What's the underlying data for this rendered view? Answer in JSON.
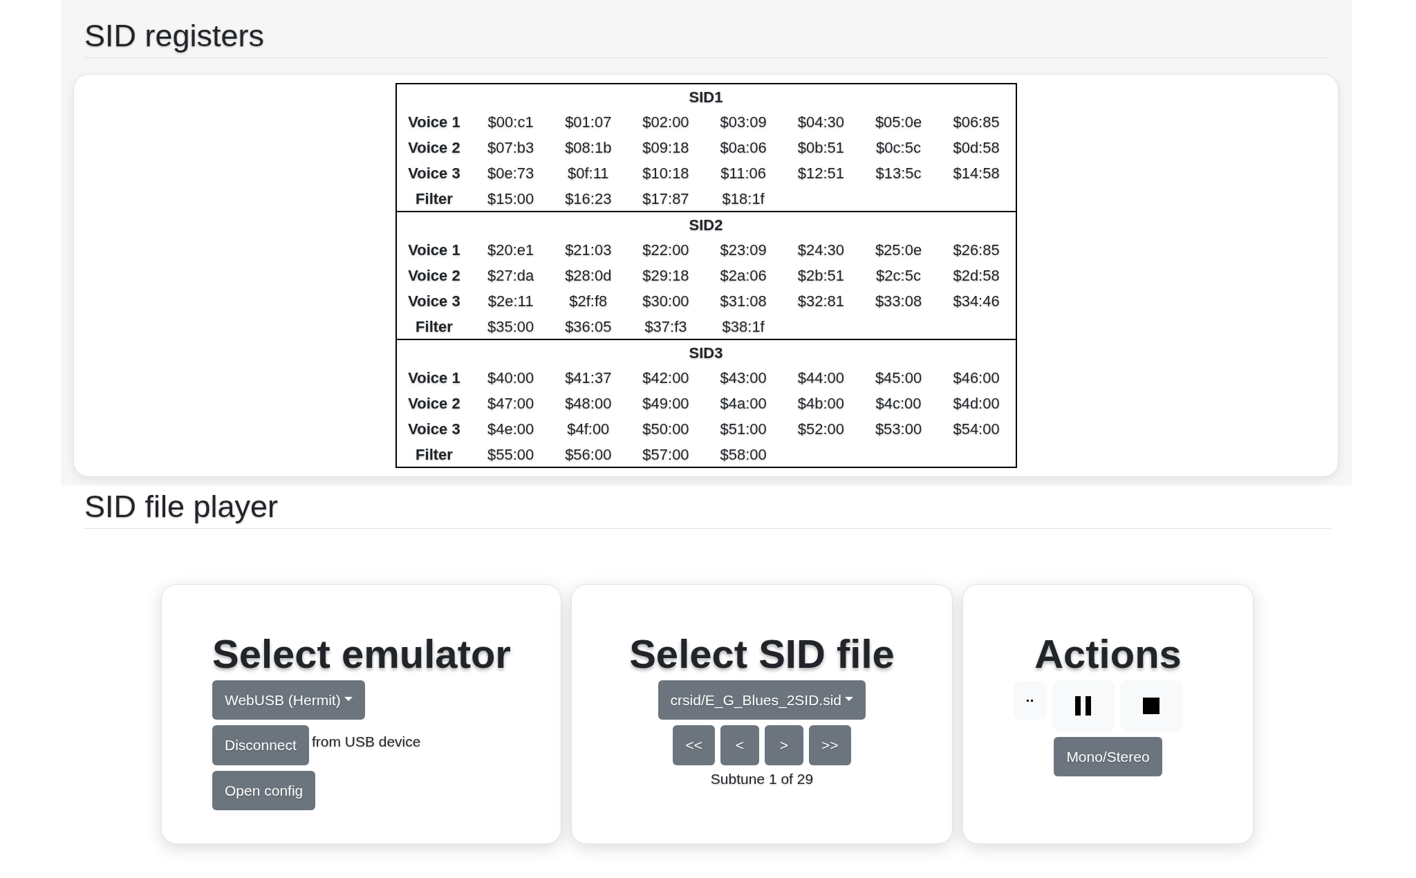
{
  "registers": {
    "heading": "SID registers",
    "chips": [
      {
        "name": "SID1",
        "rows": [
          {
            "label": "Voice 1",
            "cells": [
              "$00:c1",
              "$01:07",
              "$02:00",
              "$03:09",
              "$04:30",
              "$05:0e",
              "$06:85"
            ]
          },
          {
            "label": "Voice 2",
            "cells": [
              "$07:b3",
              "$08:1b",
              "$09:18",
              "$0a:06",
              "$0b:51",
              "$0c:5c",
              "$0d:58"
            ]
          },
          {
            "label": "Voice 3",
            "cells": [
              "$0e:73",
              "$0f:11",
              "$10:18",
              "$11:06",
              "$12:51",
              "$13:5c",
              "$14:58"
            ]
          },
          {
            "label": "Filter",
            "cells": [
              "$15:00",
              "$16:23",
              "$17:87",
              "$18:1f"
            ]
          }
        ]
      },
      {
        "name": "SID2",
        "rows": [
          {
            "label": "Voice 1",
            "cells": [
              "$20:e1",
              "$21:03",
              "$22:00",
              "$23:09",
              "$24:30",
              "$25:0e",
              "$26:85"
            ]
          },
          {
            "label": "Voice 2",
            "cells": [
              "$27:da",
              "$28:0d",
              "$29:18",
              "$2a:06",
              "$2b:51",
              "$2c:5c",
              "$2d:58"
            ]
          },
          {
            "label": "Voice 3",
            "cells": [
              "$2e:11",
              "$2f:f8",
              "$30:00",
              "$31:08",
              "$32:81",
              "$33:08",
              "$34:46"
            ]
          },
          {
            "label": "Filter",
            "cells": [
              "$35:00",
              "$36:05",
              "$37:f3",
              "$38:1f"
            ]
          }
        ]
      },
      {
        "name": "SID3",
        "rows": [
          {
            "label": "Voice 1",
            "cells": [
              "$40:00",
              "$41:37",
              "$42:00",
              "$43:00",
              "$44:00",
              "$45:00",
              "$46:00"
            ]
          },
          {
            "label": "Voice 2",
            "cells": [
              "$47:00",
              "$48:00",
              "$49:00",
              "$4a:00",
              "$4b:00",
              "$4c:00",
              "$4d:00"
            ]
          },
          {
            "label": "Voice 3",
            "cells": [
              "$4e:00",
              "$4f:00",
              "$50:00",
              "$51:00",
              "$52:00",
              "$53:00",
              "$54:00"
            ]
          },
          {
            "label": "Filter",
            "cells": [
              "$55:00",
              "$56:00",
              "$57:00",
              "$58:00"
            ]
          }
        ]
      }
    ]
  },
  "player": {
    "heading": "SID file player",
    "emulator": {
      "title": "Select emulator",
      "dropdown": "WebUSB (Hermit)",
      "disconnect": "Disconnect",
      "disconnect_note": "from USB device",
      "config": "Open config"
    },
    "sid_file": {
      "title": "Select SID file",
      "dropdown": "crsid/E_G_Blues_2SID.sid",
      "nav": [
        "<<",
        "<",
        ">",
        ">>"
      ],
      "subtune": "Subtune 1 of 29"
    },
    "actions": {
      "title": "Actions",
      "mono_stereo": "Mono/Stereo"
    }
  }
}
